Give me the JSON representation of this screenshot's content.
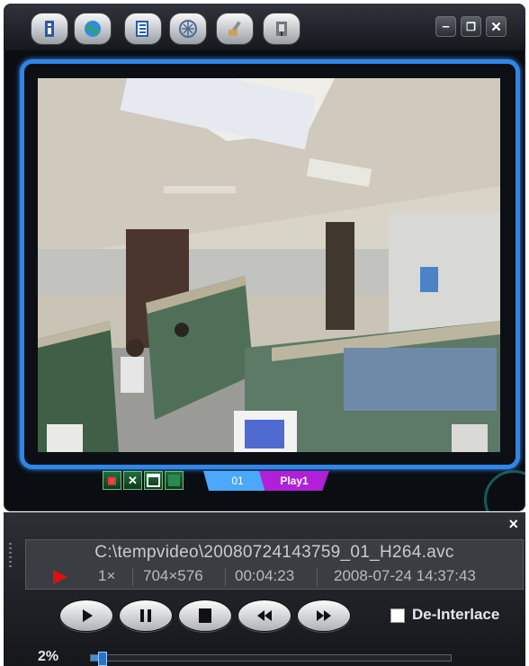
{
  "toolbar": {
    "buttons": [
      {
        "icon": "info-icon"
      },
      {
        "icon": "globe-icon"
      },
      {
        "icon": "document-list-icon"
      },
      {
        "icon": "network-icon"
      },
      {
        "icon": "tools-icon"
      },
      {
        "icon": "exit-icon"
      }
    ],
    "window_controls": {
      "minimize": "–",
      "restore": "❐",
      "close": "✕"
    }
  },
  "channel_bar": {
    "channel_label": "01",
    "playback_label": "Play1",
    "buttons": [
      {
        "icon": "snapshot-delete-icon"
      },
      {
        "icon": "close-channel-icon",
        "label": "✕"
      },
      {
        "icon": "single-view-icon"
      },
      {
        "icon": "full-view-icon"
      }
    ]
  },
  "player": {
    "close_label": "×",
    "file_path": "C:\\tempvideo\\20080724143759_01_H264.avc",
    "speed": "1×",
    "resolution": "704×576",
    "elapsed": "00:04:23",
    "datetime": "2008-07-24 14:37:43",
    "controls": [
      {
        "icon": "play-icon"
      },
      {
        "icon": "pause-icon"
      },
      {
        "icon": "stop-icon"
      },
      {
        "icon": "rewind-icon"
      },
      {
        "icon": "fast-forward-icon"
      }
    ],
    "deinterlace_label": "De-Interlace",
    "deinterlace_checked": false,
    "progress_label": "2%",
    "progress_fraction": 0.02
  },
  "colors": {
    "frame_blue": "#2f86e8",
    "play_tab": "#b020d8",
    "channel_tab": "#4aa8ff",
    "indicator_red": "#e01010"
  }
}
